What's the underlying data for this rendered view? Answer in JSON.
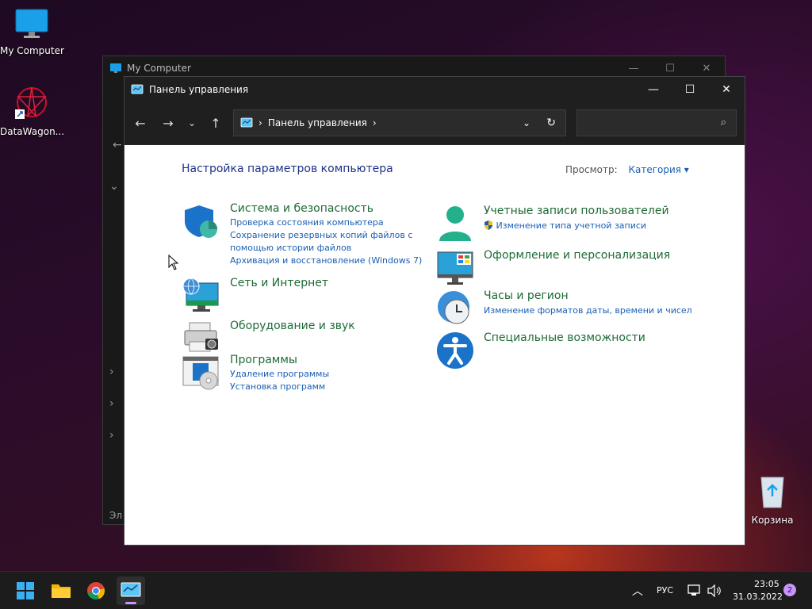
{
  "desktop": {
    "icons": [
      {
        "label": "My Computer"
      },
      {
        "label": "DataWagon..."
      },
      {
        "label": "Корзина"
      }
    ]
  },
  "back_window": {
    "title": "My Computer",
    "side_text": "Эл"
  },
  "window": {
    "title": "Панель управления",
    "breadcrumb": "Панель управления",
    "search_placeholder": ""
  },
  "content": {
    "title": "Настройка параметров компьютера",
    "view_label": "Просмотр:",
    "view_value": "Категория",
    "categories": [
      {
        "title": "Система и безопасность",
        "links": [
          "Проверка состояния компьютера",
          "Сохранение резервных копий файлов с",
          "помощью истории файлов",
          "Архивация и восстановление (Windows 7)"
        ],
        "icon": "shield-icon"
      },
      {
        "title": "Сеть и Интернет",
        "links": [],
        "icon": "network-icon"
      },
      {
        "title": "Оборудование и звук",
        "links": [],
        "icon": "printer-icon"
      },
      {
        "title": "Программы",
        "links": [
          "Удаление программы",
          "Установка программ"
        ],
        "icon": "programs-icon"
      },
      {
        "title": "Учетные записи пользователей",
        "links": [
          "Изменение типа учетной записи"
        ],
        "icon": "user-icon"
      },
      {
        "title": "Оформление и персонализация",
        "links": [],
        "icon": "monitor-icon"
      },
      {
        "title": "Часы и регион",
        "links": [
          "Изменение форматов даты, времени и чисел"
        ],
        "icon": "clock-icon"
      },
      {
        "title": "Специальные возможности",
        "links": [],
        "icon": "accessibility-icon"
      }
    ]
  },
  "taskbar": {
    "language": "РУС",
    "time": "23:05",
    "date": "31.03.2022",
    "notifications": "2"
  },
  "colors": {
    "accent": "#1a5fb4",
    "category_green": "#1e6b36",
    "title_blue": "#1e3287"
  }
}
